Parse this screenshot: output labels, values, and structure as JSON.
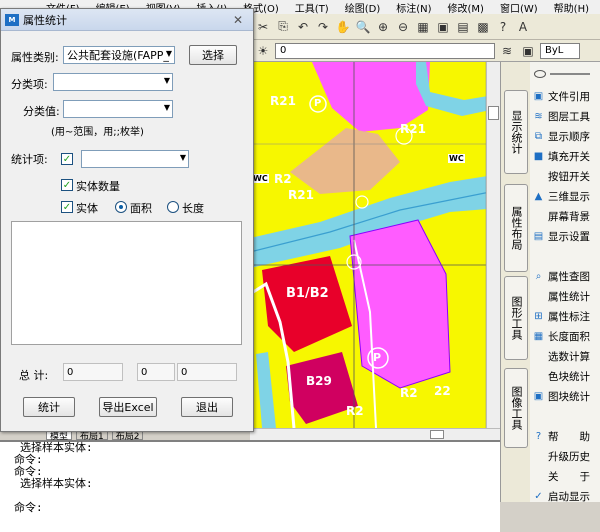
{
  "menubar": [
    "文件(F)",
    "编辑(E)",
    "视图(V)",
    "插入(I)",
    "格式(O)",
    "工具(T)",
    "绘图(D)",
    "标注(N)",
    "修改(M)",
    "窗口(W)",
    "帮助(H)"
  ],
  "toolbar": {
    "layer_value": "0",
    "bylayer": "ByL"
  },
  "dialog": {
    "title": "属性统计",
    "attr_category_label": "属性类别:",
    "attr_category_value": "公共配套设施(FAPP_",
    "select_button": "选择",
    "subitem_label": "分类项:",
    "subitem_value": "",
    "subvalue_label": "分类值:",
    "subvalue_value": "",
    "subvalue_hint": "(用~范围，用;;枚举)",
    "stat_label": "统计项:",
    "stat_value": "",
    "entity_count_label": "实体数量",
    "entity_label": "实体",
    "area_label": "面积",
    "length_label": "长度",
    "total_label": "总  计:",
    "total_values": [
      "0",
      "0",
      "0"
    ],
    "buttons": {
      "stat": "统计",
      "export": "导出Excel",
      "exit": "退出"
    }
  },
  "canvas_labels": {
    "r21_top_left": "R21",
    "r21_top_right": "R21",
    "r21_mid": "R21",
    "r2_left": "R2",
    "wc_left": "WC",
    "wc_right": "WC",
    "b1b2": "B1/B2",
    "b29": "B29",
    "r2_bottom": "R2",
    "r2_bottom_right": "R2",
    "n22": "22",
    "parking": "P"
  },
  "sidetabs": [
    "显示统计",
    "属性布局",
    "图形工具",
    "图像工具"
  ],
  "tools": [
    {
      "icon": "file-ref-icon",
      "glyph": "▣",
      "label": "文件引用"
    },
    {
      "icon": "layer-tool-icon",
      "glyph": "≋",
      "label": "图层工具"
    },
    {
      "icon": "display-order-icon",
      "glyph": "⧉",
      "label": "显示顺序"
    },
    {
      "icon": "fill-toggle-icon",
      "glyph": "■",
      "label": "填充开关"
    },
    {
      "icon": "",
      "glyph": "",
      "label": "按钮开关"
    },
    {
      "icon": "3d-view-icon",
      "glyph": "▲",
      "label": "三维显示"
    },
    {
      "icon": "",
      "glyph": "",
      "label": "屏幕背景"
    },
    {
      "icon": "display-settings-icon",
      "glyph": "▤",
      "label": "显示设置"
    },
    {
      "icon": "",
      "glyph": "",
      "label": ""
    },
    {
      "icon": "attr-query-icon",
      "glyph": "⌕",
      "label": "属性查图"
    },
    {
      "icon": "",
      "glyph": "",
      "label": "属性统计"
    },
    {
      "icon": "attr-label-icon",
      "glyph": "⊞",
      "label": "属性标注"
    },
    {
      "icon": "length-area-icon",
      "glyph": "▦",
      "label": "长度面积"
    },
    {
      "icon": "",
      "glyph": "",
      "label": "选数计算"
    },
    {
      "icon": "",
      "glyph": "",
      "label": "色块统计"
    },
    {
      "icon": "block-stat-icon",
      "glyph": "▣",
      "label": "图块统计"
    },
    {
      "icon": "",
      "glyph": "",
      "label": ""
    },
    {
      "icon": "help-icon",
      "glyph": "?",
      "label": "帮　　助"
    },
    {
      "icon": "",
      "glyph": "",
      "label": "升级历史"
    },
    {
      "icon": "",
      "glyph": "",
      "label": "关　　于"
    },
    {
      "icon": "startup-check-icon",
      "glyph": "✓",
      "label": "启动显示"
    }
  ],
  "command_lines": [
    "选择样本实体:",
    "命令:",
    "命令:",
    "选择样本实体:",
    "",
    "命令:"
  ],
  "colors": {
    "yellow": "#f7f700",
    "magenta": "#ff5cff",
    "red": "#e8002a",
    "water": "#7fd3e6",
    "tan": "#e9b88a"
  }
}
